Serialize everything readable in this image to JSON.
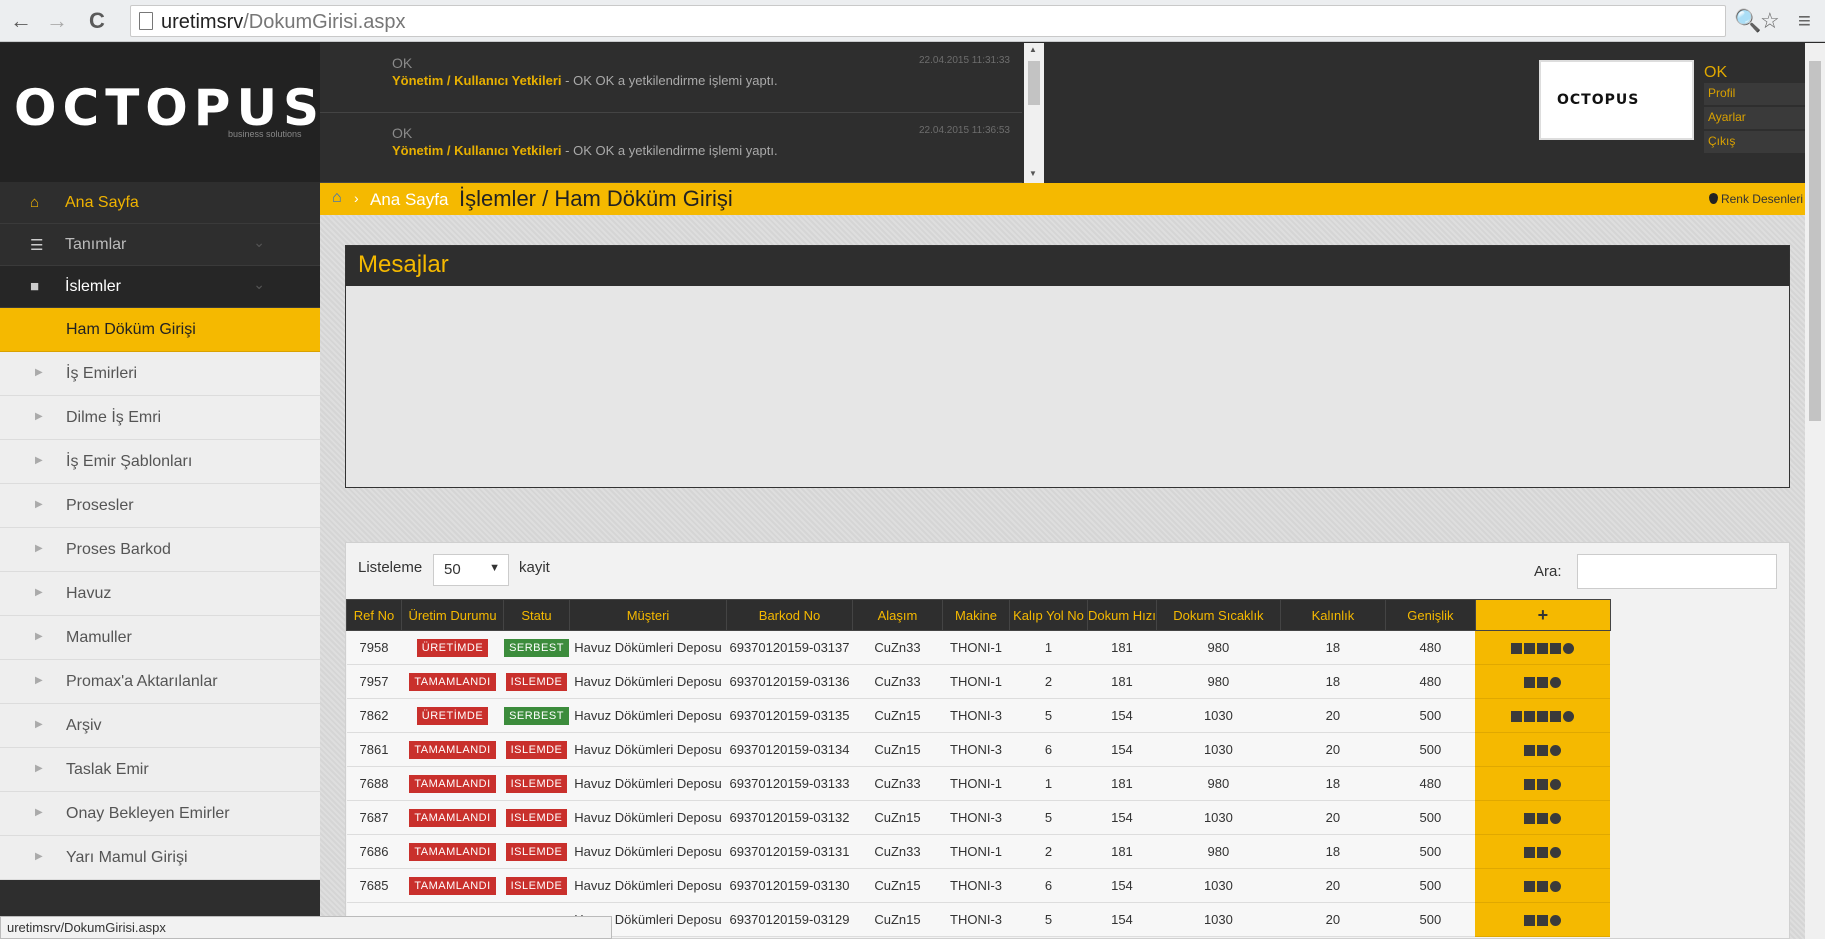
{
  "browser": {
    "url_host": "uretimsrv",
    "url_path": "/DokumGirisi.aspx",
    "back_icon": "←",
    "forward_icon": "→",
    "reload_icon": "C",
    "zoom_icon": "🔍",
    "star_icon": "☆",
    "menu_icon": "≡"
  },
  "brand": {
    "logo": "OCTOPUS",
    "sub": "business solutions"
  },
  "notifications": [
    {
      "who": "OK",
      "time": "22.04.2015 11:31:33",
      "module": "Yönetim / Kullanıcı Yetkileri",
      "text": " - OK OK a yetkilendirme işlemi yaptı."
    },
    {
      "who": "OK",
      "time": "22.04.2015 11:36:53",
      "module": "Yönetim / Kullanıcı Yetkileri",
      "text": " - OK OK a yetkilendirme işlemi yaptı."
    }
  ],
  "user": {
    "logo": "OCTOPUS",
    "name": "OK",
    "menu": [
      "Profil",
      "Ayarlar",
      "Çıkış"
    ]
  },
  "sidebar": {
    "top": [
      {
        "icon": "home-icon",
        "label": "Ana Sayfa"
      },
      {
        "icon": "list-icon",
        "label": "Tanımlar"
      },
      {
        "icon": "briefcase-icon",
        "label": "İslemler"
      }
    ],
    "sub": [
      "Ham Döküm Girişi",
      "İş Emirleri",
      "Dilme İş Emri",
      "İş Emir Şablonları",
      "Prosesler",
      "Proses Barkod",
      "Havuz",
      "Mamuller",
      "Promax'a Aktarılanlar",
      "Arşiv",
      "Taslak Emir",
      "Onay Bekleyen Emirler",
      "Yarı Mamul Girişi"
    ],
    "selected_index": 0
  },
  "breadcrumb": {
    "home": "Ana Sayfa",
    "current": "İşlemler / Ham Döküm Girişi",
    "right": "Renk Desenleri"
  },
  "messages": {
    "title": "Mesajlar"
  },
  "table": {
    "length_label": "Listeleme",
    "length_value": "50",
    "length_after": "kayit",
    "search_label": "Ara:",
    "search_value": "",
    "add_icon": "+",
    "columns": [
      "Ref No",
      "Üretim Durumu",
      "Statu",
      "Müşteri",
      "Barkod No",
      "Alaşım",
      "Makine",
      "Kalıp Yol No",
      "Dokum Hızı",
      "Dokum Sıcaklık",
      "Kalınlık",
      "Genişlik"
    ],
    "rows": [
      {
        "ref": "7958",
        "uretim": "ÜRETİMDE",
        "statu": "SERBEST",
        "musteri": "Havuz Dökümleri Deposu",
        "barkod": "69370120159-03137",
        "alasim": "CuZn33",
        "makine": "THONI-1",
        "kalip": "1",
        "hiz": "181",
        "sicaklik": "980",
        "kalinlik": "18",
        "genislik": "480",
        "full_actions": true
      },
      {
        "ref": "7957",
        "uretim": "TAMAMLANDI",
        "statu": "ISLEMDE",
        "musteri": "Havuz Dökümleri Deposu",
        "barkod": "69370120159-03136",
        "alasim": "CuZn33",
        "makine": "THONI-1",
        "kalip": "2",
        "hiz": "181",
        "sicaklik": "980",
        "kalinlik": "18",
        "genislik": "480",
        "full_actions": false
      },
      {
        "ref": "7862",
        "uretim": "ÜRETİMDE",
        "statu": "SERBEST",
        "musteri": "Havuz Dökümleri Deposu",
        "barkod": "69370120159-03135",
        "alasim": "CuZn15",
        "makine": "THONI-3",
        "kalip": "5",
        "hiz": "154",
        "sicaklik": "1030",
        "kalinlik": "20",
        "genislik": "500",
        "full_actions": true
      },
      {
        "ref": "7861",
        "uretim": "TAMAMLANDI",
        "statu": "ISLEMDE",
        "musteri": "Havuz Dökümleri Deposu",
        "barkod": "69370120159-03134",
        "alasim": "CuZn15",
        "makine": "THONI-3",
        "kalip": "6",
        "hiz": "154",
        "sicaklik": "1030",
        "kalinlik": "20",
        "genislik": "500",
        "full_actions": false
      },
      {
        "ref": "7688",
        "uretim": "TAMAMLANDI",
        "statu": "ISLEMDE",
        "musteri": "Havuz Dökümleri Deposu",
        "barkod": "69370120159-03133",
        "alasim": "CuZn33",
        "makine": "THONI-1",
        "kalip": "1",
        "hiz": "181",
        "sicaklik": "980",
        "kalinlik": "18",
        "genislik": "480",
        "full_actions": false
      },
      {
        "ref": "7687",
        "uretim": "TAMAMLANDI",
        "statu": "ISLEMDE",
        "musteri": "Havuz Dökümleri Deposu",
        "barkod": "69370120159-03132",
        "alasim": "CuZn15",
        "makine": "THONI-3",
        "kalip": "5",
        "hiz": "154",
        "sicaklik": "1030",
        "kalinlik": "20",
        "genislik": "500",
        "full_actions": false
      },
      {
        "ref": "7686",
        "uretim": "TAMAMLANDI",
        "statu": "ISLEMDE",
        "musteri": "Havuz Dökümleri Deposu",
        "barkod": "69370120159-03131",
        "alasim": "CuZn33",
        "makine": "THONI-1",
        "kalip": "2",
        "hiz": "181",
        "sicaklik": "980",
        "kalinlik": "18",
        "genislik": "500",
        "full_actions": false
      },
      {
        "ref": "7685",
        "uretim": "TAMAMLANDI",
        "statu": "ISLEMDE",
        "musteri": "Havuz Dökümleri Deposu",
        "barkod": "69370120159-03130",
        "alasim": "CuZn15",
        "makine": "THONI-3",
        "kalip": "6",
        "hiz": "154",
        "sicaklik": "1030",
        "kalinlik": "20",
        "genislik": "500",
        "full_actions": false
      },
      {
        "ref": "",
        "uretim": "",
        "statu": "",
        "musteri": "Havuz Dökümleri Deposu",
        "barkod": "69370120159-03129",
        "alasim": "CuZn15",
        "makine": "THONI-3",
        "kalip": "5",
        "hiz": "154",
        "sicaklik": "1030",
        "kalinlik": "20",
        "genislik": "500",
        "full_actions": false
      }
    ]
  },
  "status_bar": "uretimsrv/DokumGirisi.aspx",
  "colors": {
    "accent": "#f5b900",
    "dark": "#2e2e2e",
    "danger": "#c9302c",
    "success": "#3c8c3c"
  }
}
